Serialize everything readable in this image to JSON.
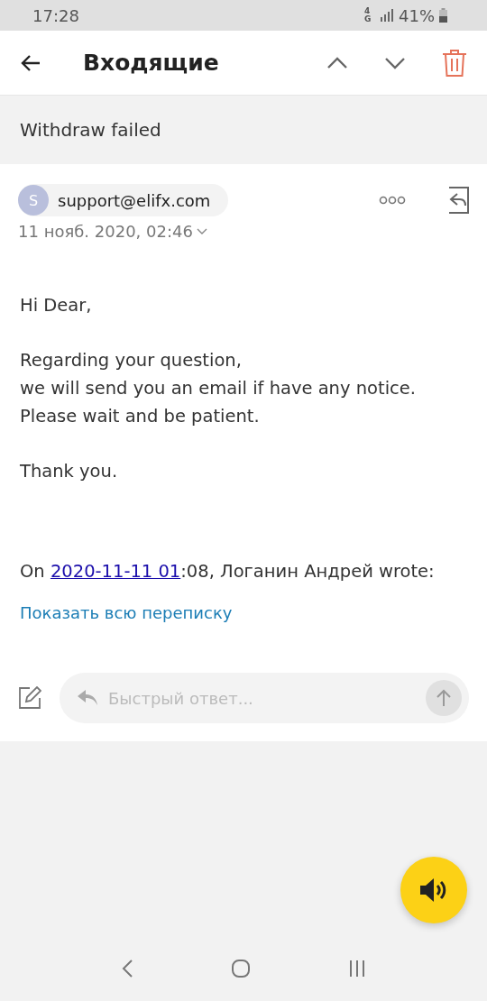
{
  "status_bar": {
    "time": "17:28",
    "network": "4G",
    "battery": "41%"
  },
  "header": {
    "title": "Входящие"
  },
  "subject": "Withdraw failed",
  "sender": {
    "initial": "S",
    "email": "support@elifx.com",
    "date": "11 нояб. 2020, 02:46"
  },
  "body": [
    "Hi Dear,",
    "Regarding your question,\nwe will send you an email if have any notice.\nPlease wait and be patient.",
    "Thank you."
  ],
  "quote_line": {
    "before": "On ",
    "link": "2020-11-11 01",
    "after": ":08, Логанин Андрей wrote:"
  },
  "show_thread_link": "Показать всю переписку",
  "quick_reply": {
    "placeholder": "Быстрый ответ..."
  }
}
